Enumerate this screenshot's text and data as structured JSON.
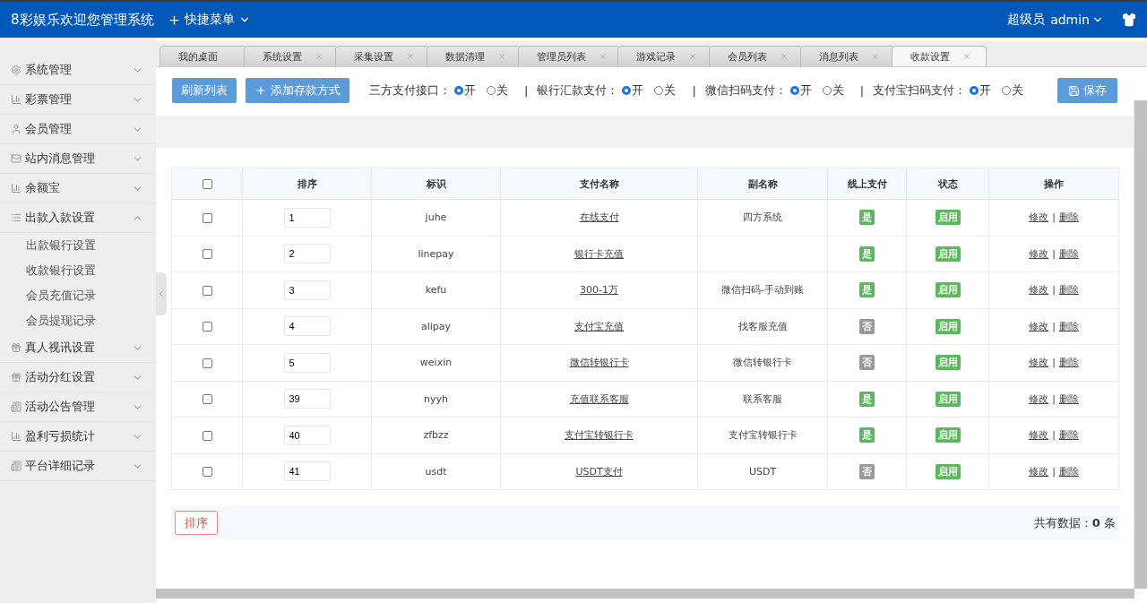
{
  "header": {
    "title": "8彩娱乐欢迎您管理系统",
    "quick_menu": "快捷菜单",
    "role": "超级员",
    "user": "admin"
  },
  "sidebar": {
    "items": [
      {
        "label": "系统管理",
        "expanded": false
      },
      {
        "label": "彩票管理",
        "expanded": false
      },
      {
        "label": "会员管理",
        "expanded": false
      },
      {
        "label": "站内消息管理",
        "expanded": false
      },
      {
        "label": "余额宝",
        "expanded": false
      },
      {
        "label": "出款入款设置",
        "expanded": true,
        "children": [
          {
            "label": "出款银行设置"
          },
          {
            "label": "收款银行设置"
          },
          {
            "label": "会员充值记录"
          },
          {
            "label": "会员提现记录"
          }
        ]
      },
      {
        "label": "真人视讯设置",
        "expanded": false
      },
      {
        "label": "活动分红设置",
        "expanded": false
      },
      {
        "label": "活动公告管理",
        "expanded": false
      },
      {
        "label": "盈利亏损统计",
        "expanded": false
      },
      {
        "label": "平台详细记录",
        "expanded": false
      }
    ]
  },
  "tabs": [
    {
      "label": "我的桌面",
      "selected": false,
      "closable": false
    },
    {
      "label": "系统设置",
      "selected": false,
      "closable": true
    },
    {
      "label": "采集设置",
      "selected": false,
      "closable": true
    },
    {
      "label": "数据清理",
      "selected": false,
      "closable": true
    },
    {
      "label": "管理员列表",
      "selected": false,
      "closable": true
    },
    {
      "label": "游戏记录",
      "selected": false,
      "closable": true
    },
    {
      "label": "会员列表",
      "selected": false,
      "closable": true
    },
    {
      "label": "消息列表",
      "selected": false,
      "closable": true
    },
    {
      "label": "收款设置",
      "selected": true,
      "closable": true
    }
  ],
  "toolbar": {
    "separator": "|",
    "refresh": "刷新列表",
    "add": "添加存款方式",
    "save": "保存",
    "switches": [
      {
        "label": "三方支付接口：",
        "options": [
          {
            "label": "开",
            "selected": true
          },
          {
            "label": "关",
            "selected": false
          }
        ]
      },
      {
        "label": "银行汇款支付：",
        "options": [
          {
            "label": "开",
            "selected": true
          },
          {
            "label": "关",
            "selected": false
          }
        ]
      },
      {
        "label": "微信扫码支付：",
        "options": [
          {
            "label": "开",
            "selected": true
          },
          {
            "label": "关",
            "selected": false
          }
        ]
      },
      {
        "label": "支付宝扫码支付：",
        "options": [
          {
            "label": "开",
            "selected": true
          },
          {
            "label": "关",
            "selected": false
          }
        ]
      }
    ]
  },
  "table": {
    "all_checked": false,
    "columns": [
      "排序",
      "标识",
      "支付名称",
      "副名称",
      "线上支付",
      "状态",
      "操作"
    ],
    "rows": [
      {
        "checked": false,
        "order": "1",
        "code": "juhe",
        "name": "在线支付",
        "alias": "四方系统",
        "online": {
          "text": "是",
          "on": true
        },
        "status": {
          "text": "启用",
          "on": true
        },
        "edit": "修改",
        "delete": "删除"
      },
      {
        "checked": false,
        "order": "2",
        "code": "linepay",
        "name": "银行卡充值",
        "online": {
          "text": "是",
          "on": true
        },
        "status": {
          "text": "启用",
          "on": true
        },
        "edit": "修改",
        "delete": "删除"
      },
      {
        "checked": false,
        "order": "3",
        "code": "kefu",
        "name": "300-1万",
        "alias": "微信扫码-手动到账",
        "online": {
          "text": "是",
          "on": true
        },
        "status": {
          "text": "启用",
          "on": true
        },
        "edit": "修改",
        "delete": "删除"
      },
      {
        "checked": false,
        "order": "4",
        "code": "alipay",
        "name": "支付宝充值",
        "alias": "找客服充值",
        "online": {
          "text": "否",
          "on": false
        },
        "status": {
          "text": "启用",
          "on": true
        },
        "edit": "修改",
        "delete": "删除"
      },
      {
        "checked": false,
        "order": "5",
        "code": "weixin",
        "name": "微信转银行卡",
        "alias": "微信转银行卡",
        "online": {
          "text": "否",
          "on": false
        },
        "status": {
          "text": "启用",
          "on": true
        },
        "edit": "修改",
        "delete": "删除"
      },
      {
        "checked": false,
        "order": "39",
        "code": "nyyh",
        "name": "充值联系客服",
        "alias": "联系客服",
        "online": {
          "text": "是",
          "on": true
        },
        "status": {
          "text": "启用",
          "on": true
        },
        "edit": "修改",
        "delete": "删除"
      },
      {
        "checked": false,
        "order": "40",
        "code": "zfbzz",
        "name": "支付宝转银行卡",
        "alias": "支付宝转银行卡",
        "online": {
          "text": "是",
          "on": true
        },
        "status": {
          "text": "启用",
          "on": true
        },
        "edit": "修改",
        "delete": "删除"
      },
      {
        "checked": false,
        "order": "41",
        "code": "usdt",
        "name": "USDT支付",
        "alias": "USDT",
        "online": {
          "text": "否",
          "on": false
        },
        "status": {
          "text": "启用",
          "on": true
        },
        "edit": "修改",
        "delete": "删除"
      }
    ]
  },
  "footer": {
    "sort": "排序",
    "total": "共有数据：**0** 条"
  }
}
